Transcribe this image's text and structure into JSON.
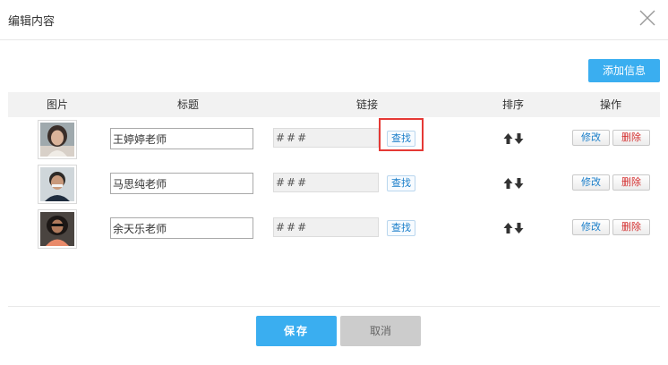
{
  "dialog": {
    "title": "编辑内容",
    "close_icon": "close-icon"
  },
  "toolbar": {
    "add_label": "添加信息"
  },
  "table": {
    "columns": [
      "图片",
      "标题",
      "链接",
      "排序",
      "操作"
    ],
    "rows": [
      {
        "title": "王婷婷老师",
        "link": "###",
        "find_label": "查找",
        "edit_label": "修改",
        "delete_label": "删除"
      },
      {
        "title": "马思纯老师",
        "link": "###",
        "find_label": "查找",
        "edit_label": "修改",
        "delete_label": "删除"
      },
      {
        "title": "余天乐老师",
        "link": "###",
        "find_label": "查找",
        "edit_label": "修改",
        "delete_label": "删除"
      }
    ]
  },
  "footer": {
    "save_label": "保存",
    "cancel_label": "取消"
  },
  "colors": {
    "accent": "#3aaef0",
    "highlight": "#e53935",
    "link_text": "#1a7ec9",
    "danger_text": "#d32f2f"
  }
}
